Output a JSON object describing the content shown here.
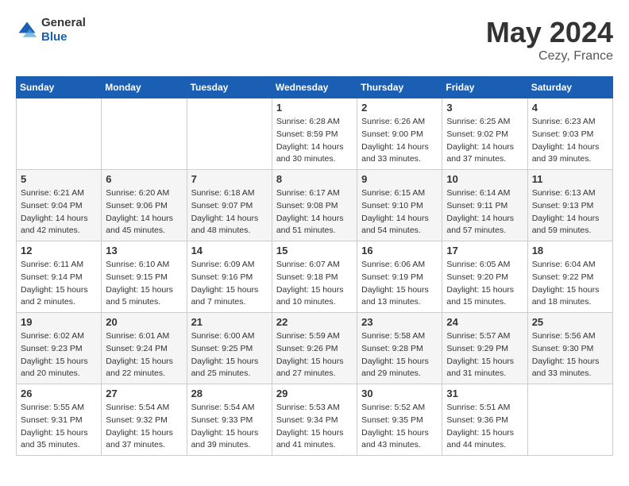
{
  "header": {
    "logo_line1": "General",
    "logo_line2": "Blue",
    "main_title": "May 2024",
    "subtitle": "Cezy, France"
  },
  "days_of_week": [
    "Sunday",
    "Monday",
    "Tuesday",
    "Wednesday",
    "Thursday",
    "Friday",
    "Saturday"
  ],
  "weeks": [
    {
      "days": [
        {
          "num": "",
          "info": ""
        },
        {
          "num": "",
          "info": ""
        },
        {
          "num": "",
          "info": ""
        },
        {
          "num": "1",
          "info": "Sunrise: 6:28 AM\nSunset: 8:59 PM\nDaylight: 14 hours\nand 30 minutes."
        },
        {
          "num": "2",
          "info": "Sunrise: 6:26 AM\nSunset: 9:00 PM\nDaylight: 14 hours\nand 33 minutes."
        },
        {
          "num": "3",
          "info": "Sunrise: 6:25 AM\nSunset: 9:02 PM\nDaylight: 14 hours\nand 37 minutes."
        },
        {
          "num": "4",
          "info": "Sunrise: 6:23 AM\nSunset: 9:03 PM\nDaylight: 14 hours\nand 39 minutes."
        }
      ]
    },
    {
      "days": [
        {
          "num": "5",
          "info": "Sunrise: 6:21 AM\nSunset: 9:04 PM\nDaylight: 14 hours\nand 42 minutes."
        },
        {
          "num": "6",
          "info": "Sunrise: 6:20 AM\nSunset: 9:06 PM\nDaylight: 14 hours\nand 45 minutes."
        },
        {
          "num": "7",
          "info": "Sunrise: 6:18 AM\nSunset: 9:07 PM\nDaylight: 14 hours\nand 48 minutes."
        },
        {
          "num": "8",
          "info": "Sunrise: 6:17 AM\nSunset: 9:08 PM\nDaylight: 14 hours\nand 51 minutes."
        },
        {
          "num": "9",
          "info": "Sunrise: 6:15 AM\nSunset: 9:10 PM\nDaylight: 14 hours\nand 54 minutes."
        },
        {
          "num": "10",
          "info": "Sunrise: 6:14 AM\nSunset: 9:11 PM\nDaylight: 14 hours\nand 57 minutes."
        },
        {
          "num": "11",
          "info": "Sunrise: 6:13 AM\nSunset: 9:13 PM\nDaylight: 14 hours\nand 59 minutes."
        }
      ]
    },
    {
      "days": [
        {
          "num": "12",
          "info": "Sunrise: 6:11 AM\nSunset: 9:14 PM\nDaylight: 15 hours\nand 2 minutes."
        },
        {
          "num": "13",
          "info": "Sunrise: 6:10 AM\nSunset: 9:15 PM\nDaylight: 15 hours\nand 5 minutes."
        },
        {
          "num": "14",
          "info": "Sunrise: 6:09 AM\nSunset: 9:16 PM\nDaylight: 15 hours\nand 7 minutes."
        },
        {
          "num": "15",
          "info": "Sunrise: 6:07 AM\nSunset: 9:18 PM\nDaylight: 15 hours\nand 10 minutes."
        },
        {
          "num": "16",
          "info": "Sunrise: 6:06 AM\nSunset: 9:19 PM\nDaylight: 15 hours\nand 13 minutes."
        },
        {
          "num": "17",
          "info": "Sunrise: 6:05 AM\nSunset: 9:20 PM\nDaylight: 15 hours\nand 15 minutes."
        },
        {
          "num": "18",
          "info": "Sunrise: 6:04 AM\nSunset: 9:22 PM\nDaylight: 15 hours\nand 18 minutes."
        }
      ]
    },
    {
      "days": [
        {
          "num": "19",
          "info": "Sunrise: 6:02 AM\nSunset: 9:23 PM\nDaylight: 15 hours\nand 20 minutes."
        },
        {
          "num": "20",
          "info": "Sunrise: 6:01 AM\nSunset: 9:24 PM\nDaylight: 15 hours\nand 22 minutes."
        },
        {
          "num": "21",
          "info": "Sunrise: 6:00 AM\nSunset: 9:25 PM\nDaylight: 15 hours\nand 25 minutes."
        },
        {
          "num": "22",
          "info": "Sunrise: 5:59 AM\nSunset: 9:26 PM\nDaylight: 15 hours\nand 27 minutes."
        },
        {
          "num": "23",
          "info": "Sunrise: 5:58 AM\nSunset: 9:28 PM\nDaylight: 15 hours\nand 29 minutes."
        },
        {
          "num": "24",
          "info": "Sunrise: 5:57 AM\nSunset: 9:29 PM\nDaylight: 15 hours\nand 31 minutes."
        },
        {
          "num": "25",
          "info": "Sunrise: 5:56 AM\nSunset: 9:30 PM\nDaylight: 15 hours\nand 33 minutes."
        }
      ]
    },
    {
      "days": [
        {
          "num": "26",
          "info": "Sunrise: 5:55 AM\nSunset: 9:31 PM\nDaylight: 15 hours\nand 35 minutes."
        },
        {
          "num": "27",
          "info": "Sunrise: 5:54 AM\nSunset: 9:32 PM\nDaylight: 15 hours\nand 37 minutes."
        },
        {
          "num": "28",
          "info": "Sunrise: 5:54 AM\nSunset: 9:33 PM\nDaylight: 15 hours\nand 39 minutes."
        },
        {
          "num": "29",
          "info": "Sunrise: 5:53 AM\nSunset: 9:34 PM\nDaylight: 15 hours\nand 41 minutes."
        },
        {
          "num": "30",
          "info": "Sunrise: 5:52 AM\nSunset: 9:35 PM\nDaylight: 15 hours\nand 43 minutes."
        },
        {
          "num": "31",
          "info": "Sunrise: 5:51 AM\nSunset: 9:36 PM\nDaylight: 15 hours\nand 44 minutes."
        },
        {
          "num": "",
          "info": ""
        }
      ]
    }
  ]
}
